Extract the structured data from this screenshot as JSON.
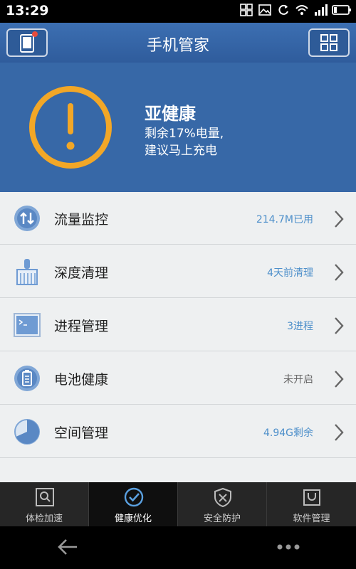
{
  "status_bar": {
    "time": "13:29"
  },
  "header": {
    "title": "手机管家"
  },
  "health": {
    "status": "亚健康",
    "line1": "剩余17%电量,",
    "line2": "建议马上充电",
    "ring_color": "#f2a727"
  },
  "items": [
    {
      "label": "流量监控",
      "value": "214.7M已用",
      "value_color": "#4d8fca",
      "icon": "data-transfer-icon"
    },
    {
      "label": "深度清理",
      "value": "4天前清理",
      "value_color": "#4d8fca",
      "icon": "broom-icon"
    },
    {
      "label": "进程管理",
      "value": "3进程",
      "value_color": "#4d8fca",
      "icon": "terminal-icon"
    },
    {
      "label": "电池健康",
      "value": "未开启",
      "value_color": "#666666",
      "icon": "battery-icon"
    },
    {
      "label": "空间管理",
      "value": "4.94G剩余",
      "value_color": "#4d8fca",
      "icon": "pie-chart-icon"
    }
  ],
  "tabs": [
    {
      "label": "体检加速",
      "icon": "scan-icon",
      "active": false
    },
    {
      "label": "健康优化",
      "icon": "check-circle-icon",
      "active": true
    },
    {
      "label": "安全防护",
      "icon": "shield-icon",
      "active": false
    },
    {
      "label": "软件管理",
      "icon": "bag-icon",
      "active": false
    }
  ],
  "colors": {
    "header": "#3c6fb2",
    "hero": "#3768a7",
    "accent": "#4d8fca"
  }
}
